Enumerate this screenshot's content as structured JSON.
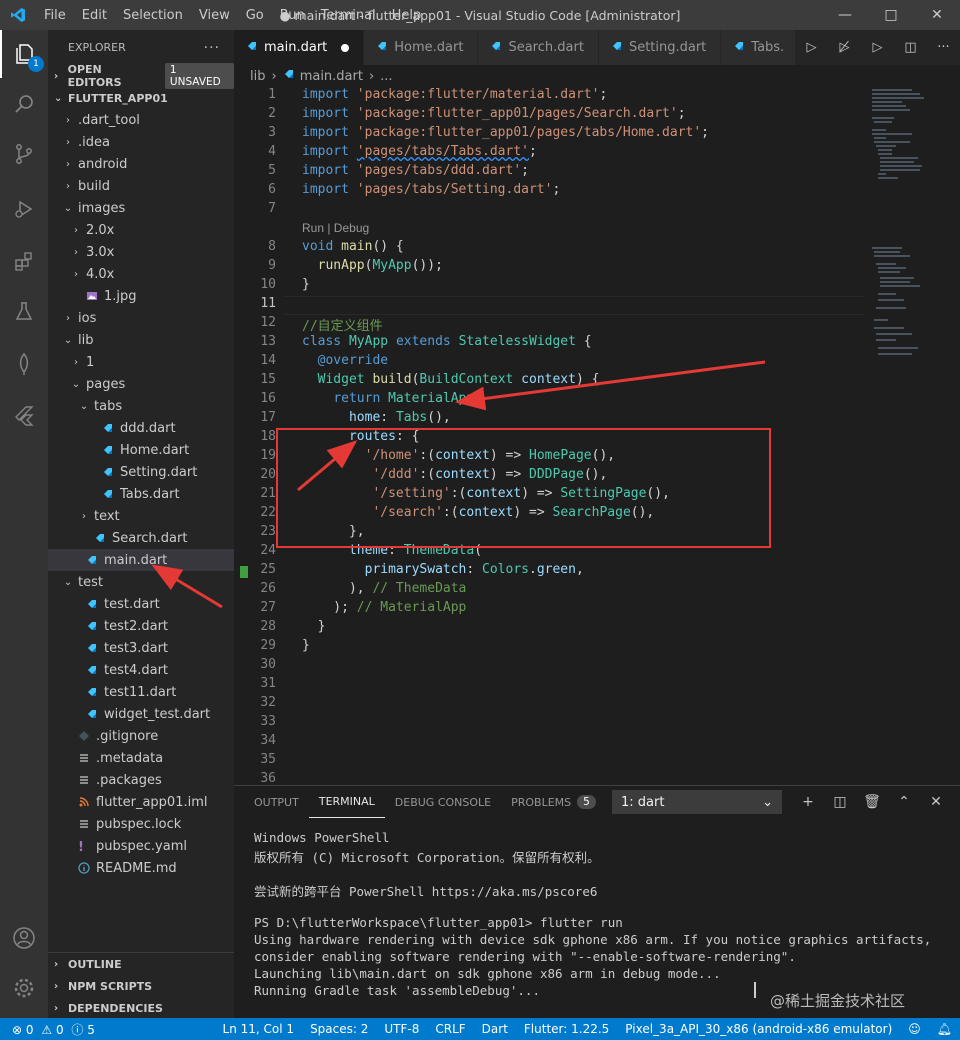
{
  "titlebar": {
    "menu": [
      "File",
      "Edit",
      "Selection",
      "View",
      "Go",
      "Run",
      "Terminal",
      "Help"
    ],
    "title": "● main.dart - flutter_app01 - Visual Studio Code [Administrator]"
  },
  "activity": {
    "explorer_badge": "1"
  },
  "sidebar": {
    "title": "EXPLORER",
    "open_editors": "OPEN EDITORS",
    "unsaved_badge": "1 UNSAVED",
    "project": "FLUTTER_APP01",
    "items": [
      {
        "label": ".dart_tool",
        "depth": 1,
        "twist": "›",
        "icon": "folder"
      },
      {
        "label": ".idea",
        "depth": 1,
        "twist": "›",
        "icon": "folder"
      },
      {
        "label": "android",
        "depth": 1,
        "twist": "›",
        "icon": "folder"
      },
      {
        "label": "build",
        "depth": 1,
        "twist": "›",
        "icon": "folder"
      },
      {
        "label": "images",
        "depth": 1,
        "twist": "⌄",
        "icon": "folder"
      },
      {
        "label": "2.0x",
        "depth": 2,
        "twist": "›",
        "icon": "folder"
      },
      {
        "label": "3.0x",
        "depth": 2,
        "twist": "›",
        "icon": "folder"
      },
      {
        "label": "4.0x",
        "depth": 2,
        "twist": "›",
        "icon": "folder"
      },
      {
        "label": "1.jpg",
        "depth": 2,
        "twist": "",
        "icon": "image"
      },
      {
        "label": "ios",
        "depth": 1,
        "twist": "›",
        "icon": "folder"
      },
      {
        "label": "lib",
        "depth": 1,
        "twist": "⌄",
        "icon": "folder"
      },
      {
        "label": "1",
        "depth": 2,
        "twist": "›",
        "icon": "folder"
      },
      {
        "label": "pages",
        "depth": 2,
        "twist": "⌄",
        "icon": "folder"
      },
      {
        "label": "tabs",
        "depth": 3,
        "twist": "⌄",
        "icon": "folder"
      },
      {
        "label": "ddd.dart",
        "depth": 4,
        "twist": "",
        "icon": "dart"
      },
      {
        "label": "Home.dart",
        "depth": 4,
        "twist": "",
        "icon": "dart"
      },
      {
        "label": "Setting.dart",
        "depth": 4,
        "twist": "",
        "icon": "dart"
      },
      {
        "label": "Tabs.dart",
        "depth": 4,
        "twist": "",
        "icon": "dart"
      },
      {
        "label": "text",
        "depth": 3,
        "twist": "›",
        "icon": "folder"
      },
      {
        "label": "Search.dart",
        "depth": 3,
        "twist": "",
        "icon": "dart"
      },
      {
        "label": "main.dart",
        "depth": 2,
        "twist": "",
        "icon": "dart",
        "selected": true
      },
      {
        "label": "test",
        "depth": 1,
        "twist": "⌄",
        "icon": "folder"
      },
      {
        "label": "test.dart",
        "depth": 2,
        "twist": "",
        "icon": "dart"
      },
      {
        "label": "test2.dart",
        "depth": 2,
        "twist": "",
        "icon": "dart"
      },
      {
        "label": "test3.dart",
        "depth": 2,
        "twist": "",
        "icon": "dart"
      },
      {
        "label": "test4.dart",
        "depth": 2,
        "twist": "",
        "icon": "dart"
      },
      {
        "label": "test11.dart",
        "depth": 2,
        "twist": "",
        "icon": "dart"
      },
      {
        "label": "widget_test.dart",
        "depth": 2,
        "twist": "",
        "icon": "dart"
      },
      {
        "label": ".gitignore",
        "depth": 1,
        "twist": "",
        "icon": "git"
      },
      {
        "label": ".metadata",
        "depth": 1,
        "twist": "",
        "icon": "lines"
      },
      {
        "label": ".packages",
        "depth": 1,
        "twist": "",
        "icon": "lines"
      },
      {
        "label": "flutter_app01.iml",
        "depth": 1,
        "twist": "",
        "icon": "rss"
      },
      {
        "label": "pubspec.lock",
        "depth": 1,
        "twist": "",
        "icon": "lines"
      },
      {
        "label": "pubspec.yaml",
        "depth": 1,
        "twist": "",
        "icon": "yaml"
      },
      {
        "label": "README.md",
        "depth": 1,
        "twist": "",
        "icon": "info"
      }
    ],
    "outline": "OUTLINE",
    "npm": "NPM SCRIPTS",
    "deps": "DEPENDENCIES"
  },
  "tabs": [
    {
      "label": "main.dart",
      "active": true,
      "dirty": true
    },
    {
      "label": "Home.dart"
    },
    {
      "label": "Search.dart"
    },
    {
      "label": "Setting.dart"
    },
    {
      "label": "Tabs."
    }
  ],
  "breadcrumb": {
    "folder": "lib",
    "file": "main.dart",
    "rest": "..."
  },
  "editor": {
    "codelens": "Run | Debug",
    "current_line": "11",
    "lines": [
      {
        "n": "1",
        "html": "<span class='k'>import</span> <span class='s'>'package:flutter/material.dart'</span>;"
      },
      {
        "n": "2",
        "html": "<span class='k'>import</span> <span class='s'>'package:flutter_app01/pages/Search.dart'</span>;"
      },
      {
        "n": "3",
        "html": "<span class='k'>import</span> <span class='s'>'package:flutter_app01/pages/tabs/Home.dart'</span>;"
      },
      {
        "n": "4",
        "html": "<span class='k'>import</span> <span class='s' style='text-decoration:underline wavy #3794ff'>'pages/tabs/Tabs.dart'</span>;"
      },
      {
        "n": "5",
        "html": "<span class='k'>import</span> <span class='s'>'pages/tabs/ddd.dart'</span>;"
      },
      {
        "n": "6",
        "html": "<span class='k'>import</span> <span class='s'>'pages/tabs/Setting.dart'</span>;"
      },
      {
        "n": "7",
        "html": ""
      },
      {
        "n": "8",
        "html": "<span class='k'>void</span> <span class='f'>main</span>() {"
      },
      {
        "n": "9",
        "html": "  <span class='f'>runApp</span>(<span class='t'>MyApp</span>());"
      },
      {
        "n": "10",
        "html": "}"
      },
      {
        "n": "11",
        "html": ""
      },
      {
        "n": "12",
        "html": "<span class='c'>//自定义组件</span>"
      },
      {
        "n": "13",
        "html": "<span class='k'>class</span> <span class='t'>MyApp</span> <span class='k'>extends</span> <span class='t'>StatelessWidget</span> {"
      },
      {
        "n": "14",
        "html": "  <span class='k'>@override</span>"
      },
      {
        "n": "15",
        "html": "  <span class='t'>Widget</span> <span class='f'>build</span>(<span class='t'>BuildContext</span> <span class='p'>context</span>) {"
      },
      {
        "n": "16",
        "html": "    <span class='k'>return</span> <span class='t'>MaterialApp</span>("
      },
      {
        "n": "17",
        "html": "      <span class='p'>home</span>: <span class='t'>Tabs</span>(),"
      },
      {
        "n": "18",
        "html": "      <span class='p'>routes</span>: {"
      },
      {
        "n": "19",
        "html": "        <span class='s'>'/home'</span>:(<span class='p'>context</span>) =&gt; <span class='t'>HomePage</span>(),"
      },
      {
        "n": "20",
        "html": "         <span class='s'>'/ddd'</span>:(<span class='p'>context</span>) =&gt; <span class='t'>DDDPage</span>(),"
      },
      {
        "n": "21",
        "html": "         <span class='s'>'/setting'</span>:(<span class='p'>context</span>) =&gt; <span class='t'>SettingPage</span>(),"
      },
      {
        "n": "22",
        "html": "         <span class='s'>'/search'</span>:(<span class='p'>context</span>) =&gt; <span class='t'>SearchPage</span>(),"
      },
      {
        "n": "23",
        "html": "      },"
      },
      {
        "n": "24",
        "html": "      <span class='p'>theme</span>: <span class='t'>ThemeData</span>("
      },
      {
        "n": "25",
        "html": "        <span class='p'>primarySwatch</span>: <span class='t'>Colors</span>.<span class='p'>green</span>,"
      },
      {
        "n": "26",
        "html": "      ), <span class='c'>// ThemeData</span>"
      },
      {
        "n": "27",
        "html": "    ); <span class='c'>// MaterialApp</span>"
      },
      {
        "n": "28",
        "html": "  }"
      },
      {
        "n": "29",
        "html": "}"
      },
      {
        "n": "30",
        "html": ""
      },
      {
        "n": "31",
        "html": ""
      },
      {
        "n": "32",
        "html": ""
      },
      {
        "n": "33",
        "html": ""
      },
      {
        "n": "34",
        "html": ""
      },
      {
        "n": "35",
        "html": ""
      },
      {
        "n": "36",
        "html": ""
      }
    ]
  },
  "panel": {
    "tabs": [
      "OUTPUT",
      "TERMINAL",
      "DEBUG CONSOLE",
      "PROBLEMS"
    ],
    "problems_count": "5",
    "terminal_select": "1: dart",
    "lines": [
      "Windows PowerShell",
      "版权所有 (C) Microsoft Corporation。保留所有权利。",
      "",
      "尝试新的跨平台 PowerShell https://aka.ms/pscore6",
      "",
      "PS D:\\flutterWorkspace\\flutter_app01> flutter run",
      "Using hardware rendering with device sdk gphone x86 arm. If you notice graphics artifacts,",
      "consider enabling software rendering with \"--enable-software-rendering\".",
      "Launching lib\\main.dart on sdk gphone x86 arm in debug mode...",
      "Running Gradle task 'assembleDebug'..."
    ]
  },
  "statusbar": {
    "errors": "0",
    "warnings": "0",
    "info": "5",
    "position": "Ln 11, Col 1",
    "spaces": "Spaces: 2",
    "encoding": "UTF-8",
    "eol": "CRLF",
    "language": "Dart",
    "flutter": "Flutter: 1.22.5",
    "device": "Pixel_3a_API_30_x86 (android-x86 emulator)"
  },
  "watermark": "@稀土掘金技术社区",
  "colors": {
    "accent": "#007acc",
    "annotation": "#e53935",
    "dart": "#40c4ff"
  }
}
